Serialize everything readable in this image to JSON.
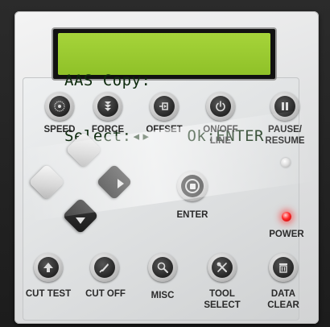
{
  "lcd": {
    "line1": "AAS Copy:",
    "line2_left": "Select:◂▸",
    "line2_right": "Ok:ENTER"
  },
  "buttons": {
    "speed": "SPEED",
    "force": "FORCE",
    "offset": "OFFSET",
    "online_1": "ON/OFF",
    "online_2": "LINE",
    "pause_1": "PAUSE/",
    "pause_2": "RESUME",
    "enter": "ENTER",
    "power": "POWER",
    "cut_test": "CUT TEST",
    "cut_off": "CUT OFF",
    "misc": "MISC",
    "tool_1": "TOOL",
    "tool_2": "SELECT",
    "data_1": "DATA",
    "data_2": "CLEAR"
  },
  "leds": {
    "pause_led": "off",
    "power_led": "on"
  },
  "colors": {
    "lcd_bg": "#9bcb30",
    "lcd_text": "#0d2a0d",
    "panel": "#e2e3e4",
    "power_led": "#ff2a2a"
  },
  "icons": {
    "speed": "speed-dial-icon",
    "force": "force-arrows-icon",
    "offset": "offset-icon",
    "online": "power-icon",
    "pause": "pause-icon",
    "cut_test": "up-arrow-icon",
    "cut_off": "knife-icon",
    "misc": "magnifier-icon",
    "tool": "tools-icon",
    "data_clear": "trash-icon"
  }
}
